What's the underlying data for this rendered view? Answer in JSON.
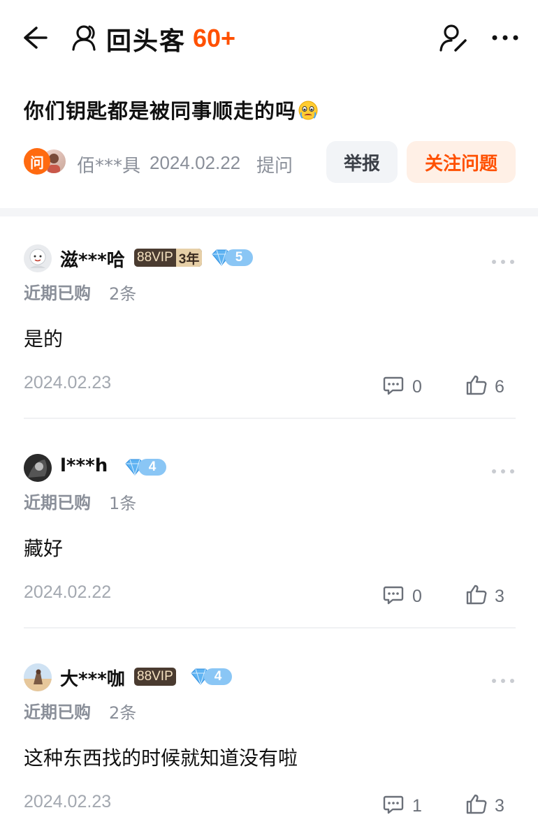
{
  "header": {
    "title": "回头客",
    "count": "60+",
    "icons": [
      "back-arrow-icon",
      "visitor-icon",
      "profile-edit-icon",
      "more-icon"
    ]
  },
  "question": {
    "text": "你们钥匙都是被同事顺走的吗",
    "emoji": "flushed-crying-emoji",
    "asker_badge": "问",
    "asker_name": "佰***具",
    "date": "2024.02.22",
    "date_suffix": "提问",
    "report_label": "举报",
    "follow_label": "关注问题"
  },
  "colors": {
    "accent": "#ff5000",
    "follow_bg": "#fff0e6",
    "report_bg": "#f2f4f7",
    "muted_text": "#8a8f99",
    "vip_badge_bg": "#4a3b30",
    "diamond_blue": "#8ac6f5"
  },
  "answers": [
    {
      "user": "滋***哈",
      "vip_label": "88VIP",
      "vip_years": "3年",
      "diamond_level": "5",
      "recent_label": "近期已购",
      "recent_count": "2条",
      "text": "是的",
      "date": "2024.02.23",
      "comments": "0",
      "likes": "6"
    },
    {
      "user": "l***h",
      "vip_label": "",
      "vip_years": "",
      "diamond_level": "4",
      "recent_label": "近期已购",
      "recent_count": "1条",
      "text": "藏好",
      "date": "2024.02.22",
      "comments": "0",
      "likes": "3"
    },
    {
      "user": "大***咖",
      "vip_label": "88VIP",
      "vip_years": "",
      "diamond_level": "4",
      "recent_label": "近期已购",
      "recent_count": "2条",
      "text": "这种东西找的时候就知道没有啦",
      "date": "2024.02.23",
      "comments": "1",
      "likes": "3"
    }
  ]
}
